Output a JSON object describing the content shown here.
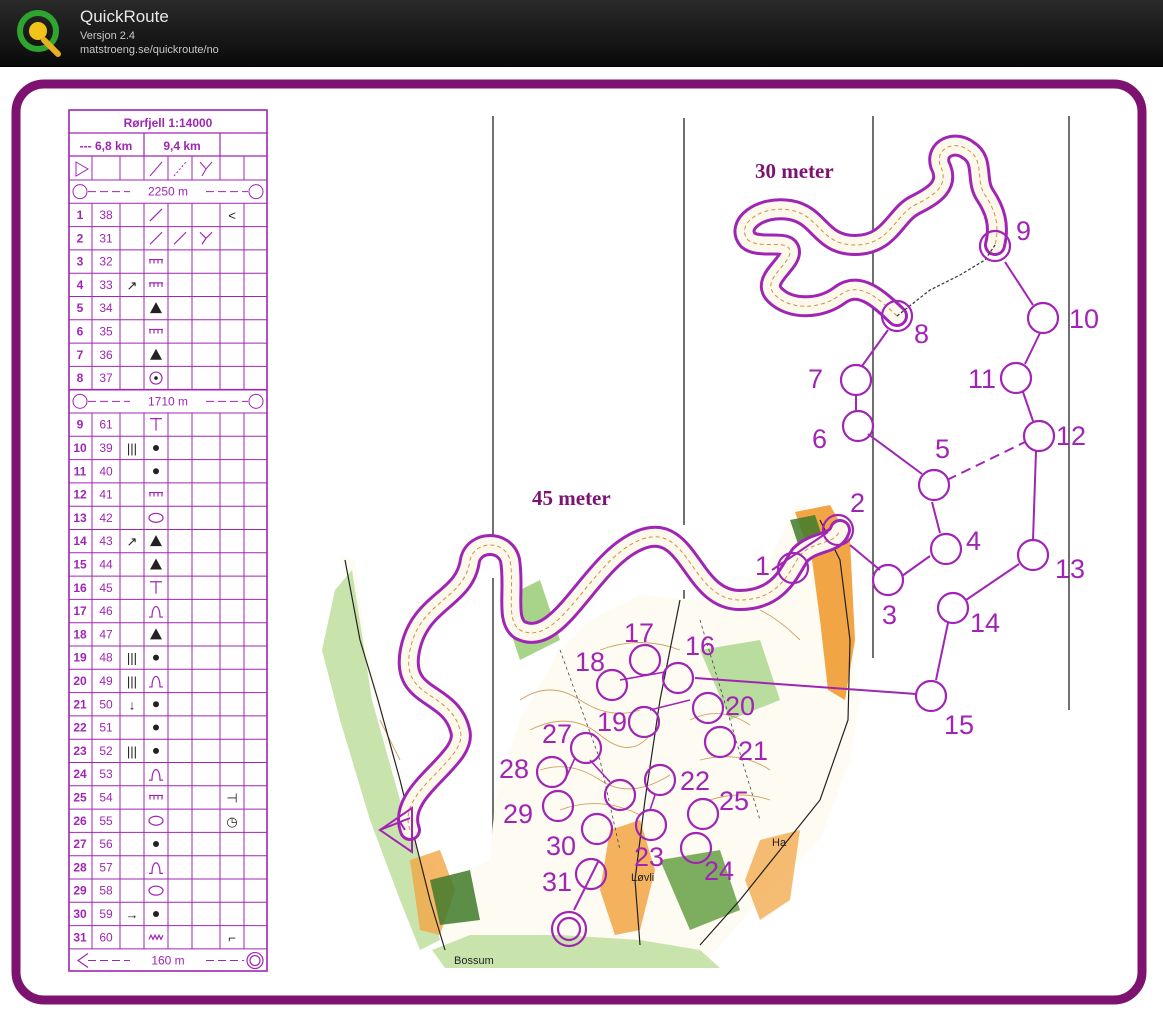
{
  "header": {
    "app_name": "QuickRoute",
    "version": "Versjon 2.4",
    "url": "matstroeng.se/quickroute/no"
  },
  "colors": {
    "course_purple": "#a025b4",
    "frame_purple": "#7d1270",
    "titlebar": "#111111",
    "terrain_yellow": "#f2a544",
    "terrain_green": "#a8d48a"
  },
  "description_sheet": {
    "title": "Rørfjell 1:14000",
    "length_short": "--- 6,8 km",
    "length_long": "9,4 km",
    "leg_marked_1": "2250 m",
    "leg_marked_2": "1710 m",
    "leg_finish": "160 m",
    "controls": [
      {
        "num": "1",
        "code": "38",
        "dir": "",
        "feature": "slash",
        "extra": "<"
      },
      {
        "num": "2",
        "code": "31",
        "dir": "",
        "feature": "slash",
        "extra": ""
      },
      {
        "num": "3",
        "code": "32",
        "dir": "",
        "feature": "cliff",
        "extra": ""
      },
      {
        "num": "4",
        "code": "33",
        "dir": "↗",
        "feature": "cliff",
        "extra": ""
      },
      {
        "num": "5",
        "code": "34",
        "dir": "",
        "feature": "triangle",
        "extra": ""
      },
      {
        "num": "6",
        "code": "35",
        "dir": "",
        "feature": "cliff",
        "extra": ""
      },
      {
        "num": "7",
        "code": "36",
        "dir": "",
        "feature": "triangle",
        "extra": ""
      },
      {
        "num": "8",
        "code": "37",
        "dir": "",
        "feature": "circle-dot",
        "extra": ""
      },
      {
        "num": "9",
        "code": "61",
        "dir": "",
        "feature": "T",
        "extra": ""
      },
      {
        "num": "10",
        "code": "39",
        "dir": "|||",
        "feature": "dot",
        "extra": ""
      },
      {
        "num": "11",
        "code": "40",
        "dir": "",
        "feature": "dot",
        "extra": ""
      },
      {
        "num": "12",
        "code": "41",
        "dir": "",
        "feature": "cliff",
        "extra": ""
      },
      {
        "num": "13",
        "code": "42",
        "dir": "",
        "feature": "ellipse",
        "extra": ""
      },
      {
        "num": "14",
        "code": "43",
        "dir": "↗",
        "feature": "triangle",
        "extra": ""
      },
      {
        "num": "15",
        "code": "44",
        "dir": "",
        "feature": "triangle",
        "extra": ""
      },
      {
        "num": "16",
        "code": "45",
        "dir": "",
        "feature": "T",
        "extra": ""
      },
      {
        "num": "17",
        "code": "46",
        "dir": "",
        "feature": "hill",
        "extra": ""
      },
      {
        "num": "18",
        "code": "47",
        "dir": "",
        "feature": "triangle",
        "extra": ""
      },
      {
        "num": "19",
        "code": "48",
        "dir": "|||",
        "feature": "dot",
        "extra": ""
      },
      {
        "num": "20",
        "code": "49",
        "dir": "|||",
        "feature": "hill",
        "extra": ""
      },
      {
        "num": "21",
        "code": "50",
        "dir": "↓",
        "feature": "dot",
        "extra": ""
      },
      {
        "num": "22",
        "code": "51",
        "dir": "",
        "feature": "dot",
        "extra": ""
      },
      {
        "num": "23",
        "code": "52",
        "dir": "|||",
        "feature": "dot",
        "extra": ""
      },
      {
        "num": "24",
        "code": "53",
        "dir": "",
        "feature": "hill",
        "extra": ""
      },
      {
        "num": "25",
        "code": "54",
        "dir": "",
        "feature": "cliff",
        "extra": "⊣"
      },
      {
        "num": "26",
        "code": "55",
        "dir": "",
        "feature": "ellipse",
        "extra": "◷"
      },
      {
        "num": "27",
        "code": "56",
        "dir": "",
        "feature": "dot",
        "extra": ""
      },
      {
        "num": "28",
        "code": "57",
        "dir": "",
        "feature": "hill",
        "extra": ""
      },
      {
        "num": "29",
        "code": "58",
        "dir": "",
        "feature": "ellipse",
        "extra": ""
      },
      {
        "num": "30",
        "code": "59",
        "dir": "→",
        "feature": "dot",
        "extra": ""
      },
      {
        "num": "31",
        "code": "60",
        "dir": "",
        "feature": "zigzag",
        "extra": "⌐"
      }
    ]
  },
  "map": {
    "label_30m": "30 meter",
    "label_45m": "45 meter",
    "place_bossum": "Bossum",
    "place_lovli": "Løvli",
    "place_ha": "Ha",
    "control_labels": [
      "1",
      "2",
      "3",
      "4",
      "5",
      "6",
      "7",
      "8",
      "9",
      "10",
      "11",
      "12",
      "13",
      "14",
      "15",
      "16",
      "17",
      "18",
      "19",
      "20",
      "21",
      "22",
      "23",
      "24",
      "25",
      "27",
      "28",
      "29",
      "30",
      "31"
    ]
  }
}
